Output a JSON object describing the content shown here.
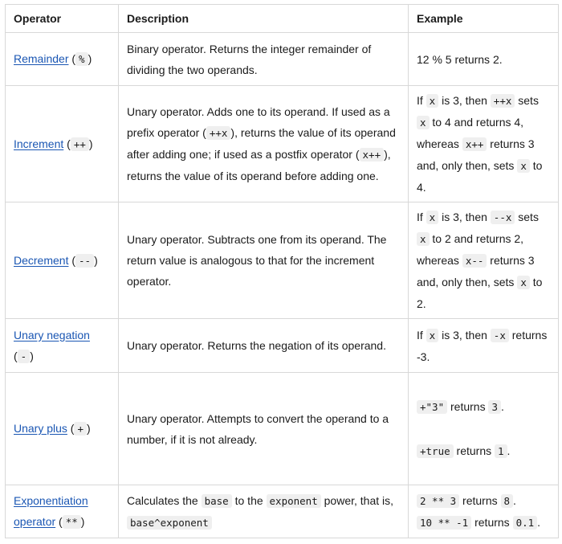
{
  "headers": {
    "operator": "Operator",
    "description": "Description",
    "example": "Example"
  },
  "rows": [
    {
      "name": "Remainder",
      "symbol": "%",
      "desc": [
        {
          "t": "Binary operator. Returns the integer remainder of dividing the two operands."
        }
      ],
      "ex": [
        [
          {
            "t": "12 % 5 returns 2."
          }
        ]
      ]
    },
    {
      "name": "Increment",
      "symbol": "++",
      "desc": [
        {
          "t": "Unary operator. Adds one to its operand. If used as a prefix operator ("
        },
        {
          "c": "++x"
        },
        {
          "t": "), returns the value of its operand after adding one; if used as a postfix operator ("
        },
        {
          "c": "x++"
        },
        {
          "t": "), returns the value of its operand before adding one."
        }
      ],
      "ex": [
        [
          {
            "t": "If "
          },
          {
            "c": "x"
          },
          {
            "t": " is 3, then "
          },
          {
            "c": "++x"
          },
          {
            "t": " sets "
          },
          {
            "c": "x"
          },
          {
            "t": " to 4 and returns 4, whereas "
          },
          {
            "c": "x++"
          },
          {
            "t": " returns 3 and, only then, sets "
          },
          {
            "c": "x"
          },
          {
            "t": " to 4."
          }
        ]
      ]
    },
    {
      "name": "Decrement",
      "symbol": "--",
      "desc": [
        {
          "t": "Unary operator. Subtracts one from its operand. The return value is analogous to that for the increment operator."
        }
      ],
      "ex": [
        [
          {
            "t": "If "
          },
          {
            "c": "x"
          },
          {
            "t": " is 3, then "
          },
          {
            "c": "--x"
          },
          {
            "t": " sets "
          },
          {
            "c": "x"
          },
          {
            "t": " to 2 and returns 2, whereas "
          },
          {
            "c": "x--"
          },
          {
            "t": " returns 3 and, only then, sets "
          },
          {
            "c": "x"
          },
          {
            "t": " to 2."
          }
        ]
      ]
    },
    {
      "name": "Unary negation",
      "symbol": "-",
      "desc": [
        {
          "t": "Unary operator. Returns the negation of its operand."
        }
      ],
      "ex": [
        [
          {
            "t": "If "
          },
          {
            "c": "x"
          },
          {
            "t": " is 3, then "
          },
          {
            "c": "-x"
          },
          {
            "t": " returns -3."
          }
        ]
      ]
    },
    {
      "name": "Unary plus",
      "symbol": "+",
      "desc": [
        {
          "t": "Unary operator. Attempts to convert the operand to a number, if it is not already."
        }
      ],
      "ex": [
        [
          {
            "c": "+\"3\""
          },
          {
            "t": " returns "
          },
          {
            "c": "3"
          },
          {
            "t": "."
          }
        ],
        [
          {
            "c": "+true"
          },
          {
            "t": " returns "
          },
          {
            "c": "1"
          },
          {
            "t": "."
          }
        ]
      ],
      "ex_gap": true
    },
    {
      "name": "Exponentiation operator",
      "symbol": "**",
      "desc": [
        {
          "t": "Calculates the "
        },
        {
          "c": "base"
        },
        {
          "t": " to the "
        },
        {
          "c": "exponent"
        },
        {
          "t": " power, that is, "
        },
        {
          "c": "base^exponent"
        }
      ],
      "ex": [
        [
          {
            "c": "2 ** 3"
          },
          {
            "t": " returns "
          },
          {
            "c": "8"
          },
          {
            "t": "."
          }
        ],
        [
          {
            "c": "10 ** -1"
          },
          {
            "t": " returns "
          },
          {
            "c": "0.1"
          },
          {
            "t": "."
          }
        ]
      ]
    }
  ]
}
